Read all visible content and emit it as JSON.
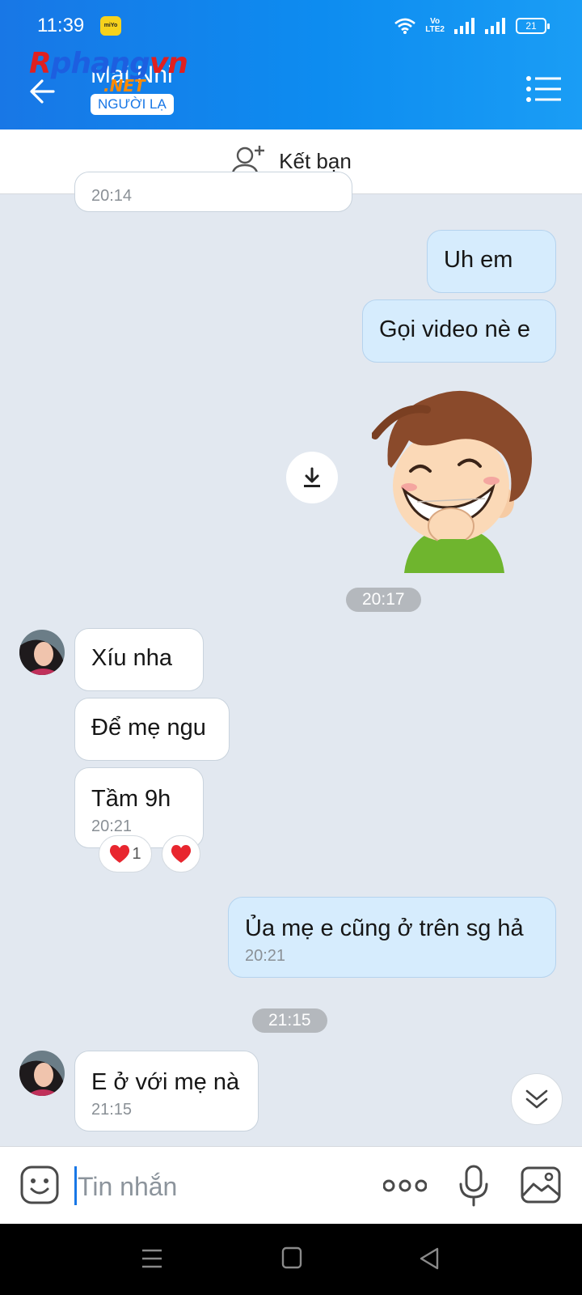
{
  "status_bar": {
    "time": "11:39",
    "app_badge": "miYo",
    "volte": "Vo\nLTE2",
    "battery": "21"
  },
  "header": {
    "contact_name": "Mai Nhi",
    "stranger_label": "NGƯỜI LẠ"
  },
  "watermark": {
    "main_a": "R",
    "main_b": "phang",
    "main_c": "vn",
    "net": ".NET"
  },
  "friend_bar": {
    "label": "Kết bạn"
  },
  "messages": [
    {
      "time": "20:14"
    },
    {
      "text": "Uh em"
    },
    {
      "text": "Gọi video nè e"
    },
    {
      "text": "Xíu nha"
    },
    {
      "text": "Để mẹ ngu"
    },
    {
      "text": "Tầm 9h",
      "time": "20:21"
    },
    {
      "text": "Ủa mẹ e cũng ở trên sg hả",
      "time": "20:21"
    },
    {
      "text": "E ở với mẹ nà",
      "time": "21:15"
    }
  ],
  "separators": [
    "20:17",
    "21:15"
  ],
  "reactions": [
    {
      "emoji": "heart",
      "count": "1"
    },
    {
      "emoji": "heart"
    }
  ],
  "input": {
    "placeholder": "Tin nhắn"
  },
  "colors": {
    "header_start": "#1877e6",
    "header_end": "#1a9df5",
    "outgoing_bubble": "#d6ecfd",
    "incoming_bubble": "#ffffff",
    "background": "#e2e8f0"
  }
}
